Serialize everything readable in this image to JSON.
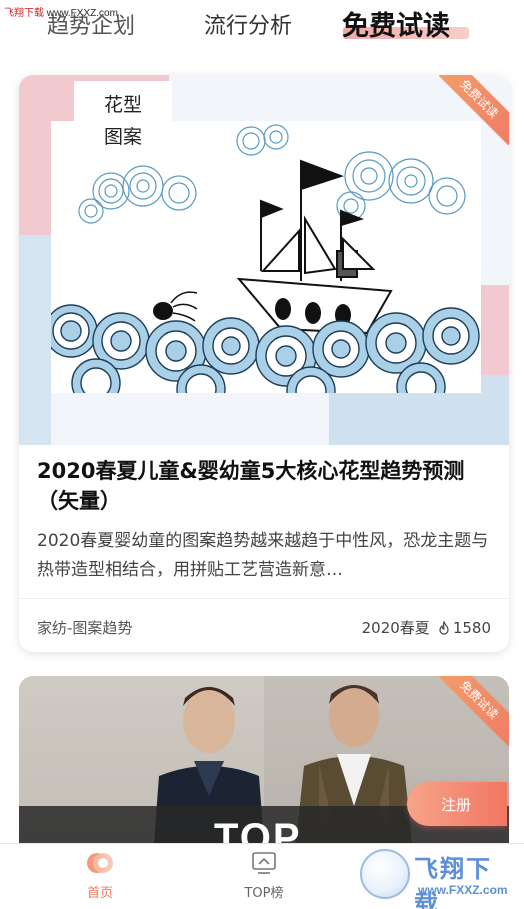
{
  "watermark_top": {
    "brand": "飞翔下载",
    "site": "www.FXXZ.com"
  },
  "tabs": [
    {
      "label": "趋势企划"
    },
    {
      "label": "流行分析"
    },
    {
      "label": "免费试读",
      "active": true
    }
  ],
  "card1": {
    "cover_label_line1": "花型",
    "cover_label_line2": "图案",
    "ribbon": "免费试读",
    "title": "2020春夏儿童&婴幼童5大核心花型趋势预测（矢量）",
    "description": "2020春夏婴幼童的图案趋势越来越趋于中性风，恐龙主题与热带造型相结合，用拼贴工艺营造新意…",
    "category": "家纺-图案趋势",
    "season": "2020春夏",
    "views": "1580"
  },
  "card2": {
    "ribbon": "免费试读",
    "overlay_text": "TOP"
  },
  "register_button": "注册",
  "bottom_nav": [
    {
      "label": "首页",
      "icon": "home-icon",
      "active": true
    },
    {
      "label": "TOP榜",
      "icon": "top-chart-icon"
    }
  ],
  "watermark_logo": {
    "brand": "飞翔下载",
    "site": "www.FXXZ.com"
  },
  "colors": {
    "accent": "#f07b66",
    "ribbon_start": "#f4a06a",
    "frame_pink": "#f2c9cf",
    "frame_blue": "#cfe1ee"
  }
}
